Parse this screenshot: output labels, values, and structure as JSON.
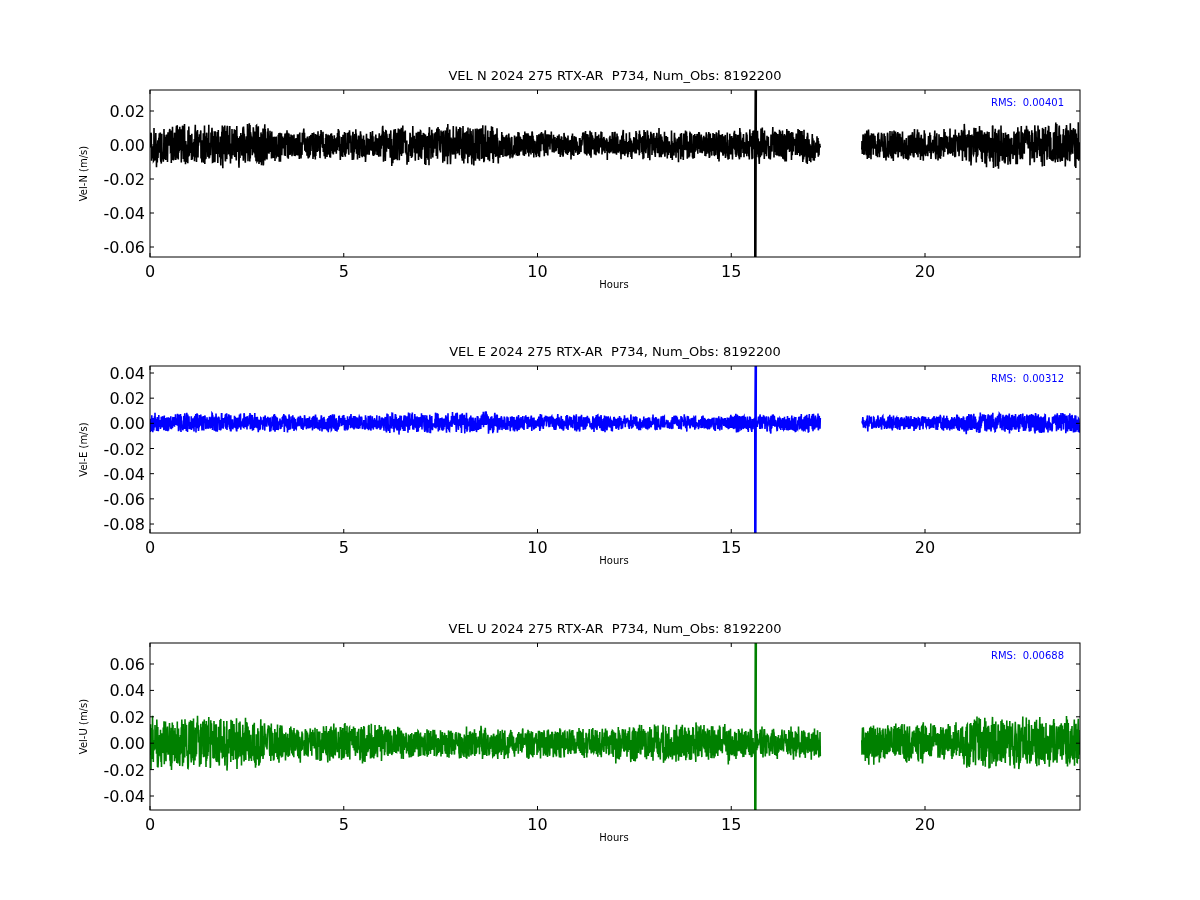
{
  "panels": [
    {
      "title": "VEL N 2024 275 RTX-AR  P734, Num_Obs: 8192200",
      "ylabel": "Vel-N (m/s)",
      "xlabel": "Hours",
      "xticks": [
        "0",
        "5",
        "10",
        "15",
        "20"
      ],
      "yticks": [
        "0.02",
        "0.00",
        "-0.02",
        "-0.04",
        "-0.06"
      ],
      "rms": "RMS:  0.00401",
      "color": "#000000"
    },
    {
      "title": "VEL E 2024 275 RTX-AR  P734, Num_Obs: 8192200",
      "ylabel": "Vel-E (m/s)",
      "xlabel": "Hours",
      "xticks": [
        "0",
        "5",
        "10",
        "15",
        "20"
      ],
      "yticks": [
        "0.04",
        "0.02",
        "0.00",
        "-0.02",
        "-0.04",
        "-0.06",
        "-0.08"
      ],
      "rms": "RMS:  0.00312",
      "color": "#0000ff"
    },
    {
      "title": "VEL U 2024 275 RTX-AR  P734, Num_Obs: 8192200",
      "ylabel": "Vel-U (m/s)",
      "xlabel": "Hours",
      "xticks": [
        "0",
        "5",
        "10",
        "15",
        "20"
      ],
      "yticks": [
        "0.06",
        "0.04",
        "0.02",
        "0.00",
        "-0.02",
        "-0.04"
      ],
      "rms": "RMS:  0.00688",
      "color": "#008000"
    }
  ]
}
